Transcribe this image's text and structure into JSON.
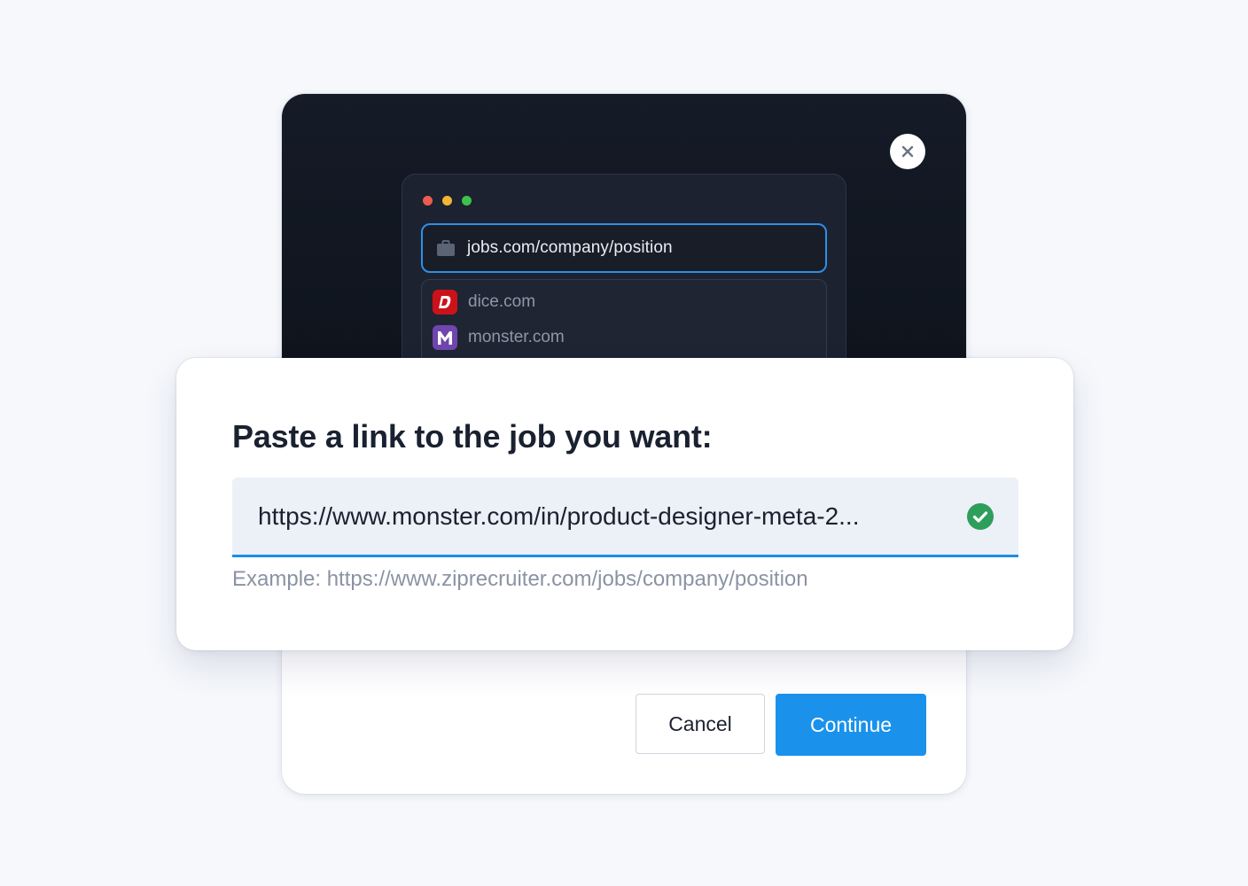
{
  "browser_preview": {
    "url": "jobs.com/company/position",
    "suggestions": [
      {
        "label": "dice.com",
        "logo": "D",
        "icon": "dice-logo-icon",
        "color": "#cc1219"
      },
      {
        "label": "monster.com",
        "logo": "M",
        "icon": "monster-logo-icon",
        "color": "#6e46ae"
      }
    ]
  },
  "dialog": {
    "title": "Paste a link to the job you want:",
    "link_value": "https://www.monster.com/in/product-designer-meta-2...",
    "example": "Example: https://www.ziprecruiter.com/jobs/company/position",
    "cancel_label": "Cancel",
    "continue_label": "Continue"
  },
  "colors": {
    "accent": "#1a92ec",
    "success": "#2e9e5b",
    "dark_panel": "#0f141d"
  }
}
